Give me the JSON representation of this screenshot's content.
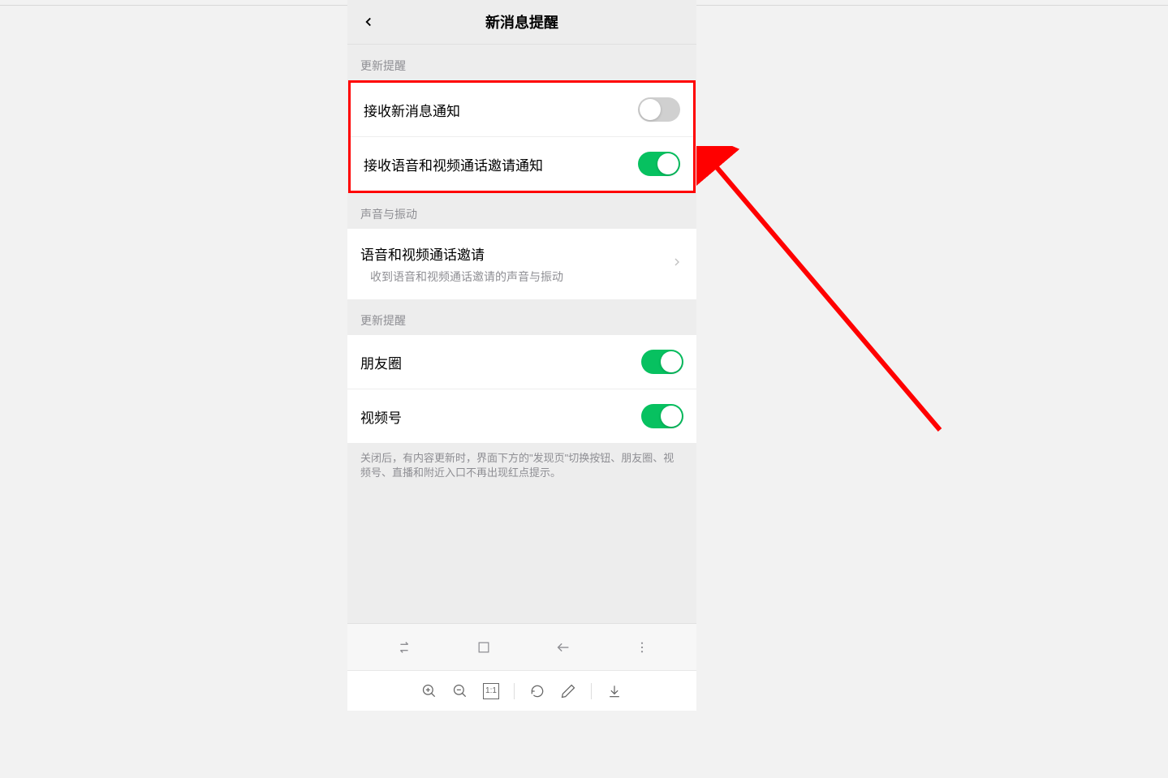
{
  "header": {
    "title": "新消息提醒"
  },
  "sections": [
    {
      "header": "更新提醒",
      "items": [
        {
          "label": "接收新消息通知",
          "toggle": false
        },
        {
          "label": "接收语音和视频通话邀请通知",
          "toggle": true
        }
      ]
    },
    {
      "header": "声音与振动",
      "items": [
        {
          "label": "语音和视频通话邀请",
          "sublabel": "收到语音和视频通话邀请的声音与振动",
          "chevron": true
        }
      ]
    },
    {
      "header": "更新提醒",
      "items": [
        {
          "label": "朋友圈",
          "toggle": true
        },
        {
          "label": "视频号",
          "toggle": true
        }
      ]
    }
  ],
  "footer_note": "关闭后，有内容更新时，界面下方的\"发现页\"切换按钮、朋友圈、视频号、直播和附近入口不再出现红点提示。",
  "toolbar": {
    "zoom_value": "1:1"
  }
}
